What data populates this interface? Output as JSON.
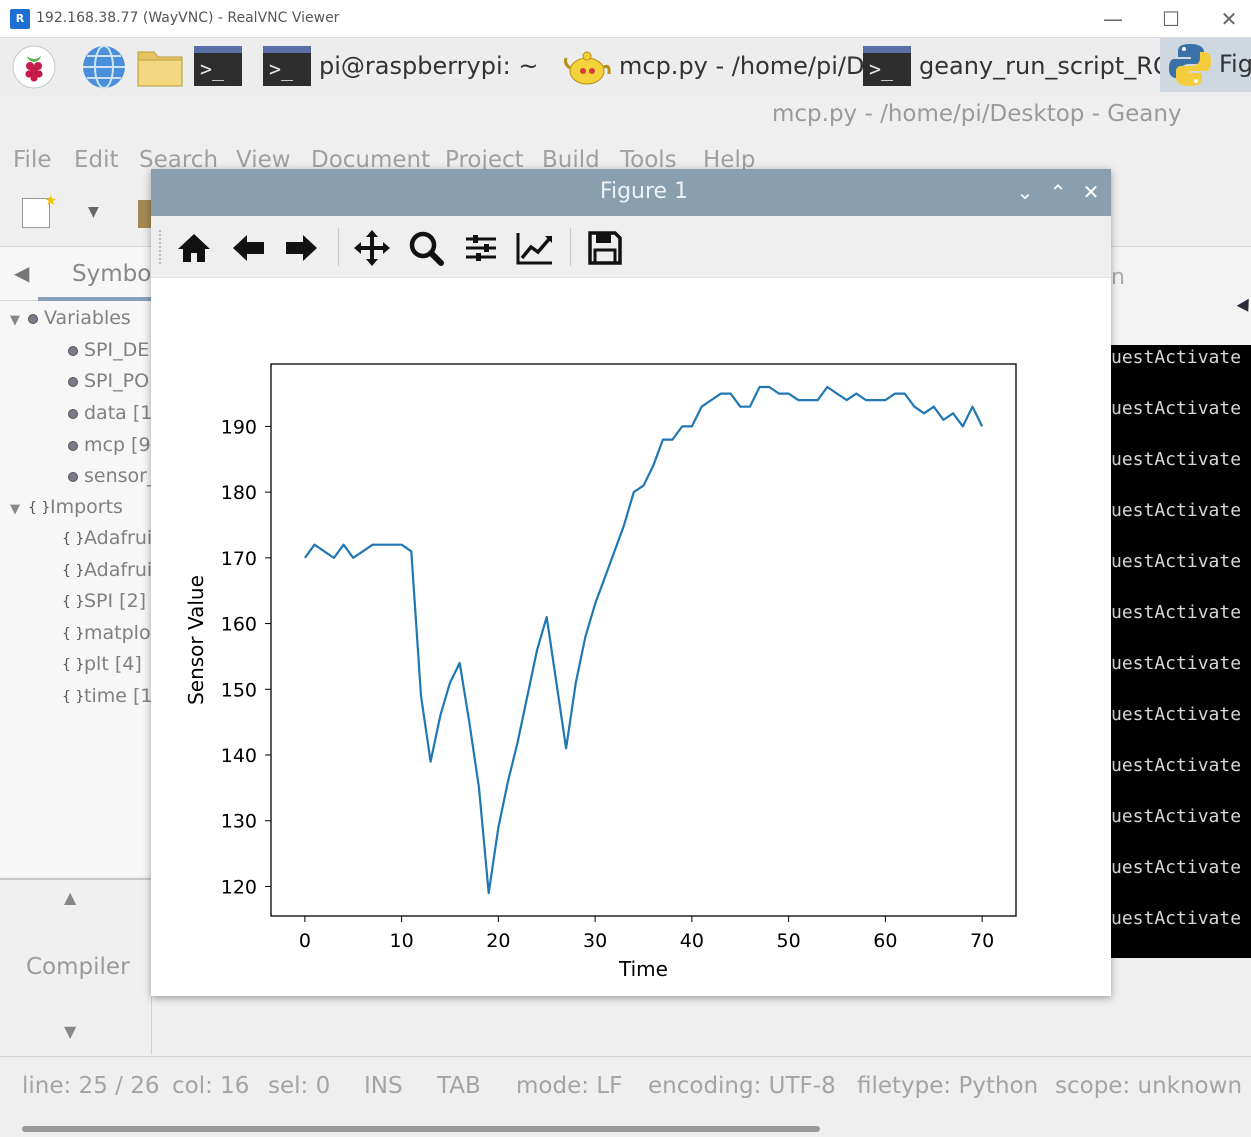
{
  "vnc": {
    "title": "192.168.38.77 (WayVNC) - RealVNC Viewer",
    "logo": "R"
  },
  "taskbar": {
    "tasks": [
      {
        "label": "pi@raspberrypi: ~"
      },
      {
        "label": "mcp.py - /home/pi/D.."
      },
      {
        "label": "geany_run_script_RO.."
      },
      {
        "label": "Fig"
      }
    ],
    "terminal_glyph": ">_"
  },
  "geany": {
    "title": "mcp.py - /home/pi/Desktop - Geany",
    "menu": [
      "File",
      "Edit",
      "Search",
      "View",
      "Document",
      "Project",
      "Build",
      "Tools",
      "Help"
    ],
    "sidebar_tab": "Symbol",
    "tree": [
      {
        "label": "Variables",
        "kind": "group"
      },
      {
        "label": "SPI_DE",
        "kind": "var"
      },
      {
        "label": "SPI_PO",
        "kind": "var"
      },
      {
        "label": "data [1",
        "kind": "var"
      },
      {
        "label": "mcp [9",
        "kind": "var"
      },
      {
        "label": "sensor_",
        "kind": "var"
      },
      {
        "label": "Imports",
        "kind": "group"
      },
      {
        "label": "Adafrui",
        "kind": "import"
      },
      {
        "label": "Adafrui",
        "kind": "import"
      },
      {
        "label": "SPI [2]",
        "kind": "import"
      },
      {
        "label": "matplo",
        "kind": "import"
      },
      {
        "label": "plt [4]",
        "kind": "import"
      },
      {
        "label": "time [1",
        "kind": "import"
      }
    ],
    "compiler_label": "Compiler",
    "terminal_text": "uestActivate",
    "terminal_lines": 12,
    "right_tab_fragment": "n",
    "status": {
      "line": "line: 25 / 26",
      "col": "col: 16",
      "sel": "sel: 0",
      "ins": "INS",
      "tab": "TAB",
      "mode": "mode: LF",
      "encoding": "encoding: UTF-8",
      "filetype": "filetype: Python",
      "scope": "scope: unknown"
    }
  },
  "figure": {
    "title": "Figure 1",
    "toolbar_icons": [
      "home-icon",
      "back-arrow-icon",
      "forward-arrow-icon",
      "pan-move-icon",
      "zoom-magnifier-icon",
      "configure-subplots-icon",
      "edit-axis-icon",
      "save-floppy-icon"
    ],
    "line_color": "#1f77b4"
  },
  "chart_data": {
    "type": "line",
    "title": "",
    "xlabel": "Time",
    "ylabel": "Sensor Value",
    "xlim": [
      -3.5,
      73.5
    ],
    "ylim": [
      115.5,
      199.5
    ],
    "xticks": [
      0,
      10,
      20,
      30,
      40,
      50,
      60,
      70
    ],
    "yticks": [
      120,
      130,
      140,
      150,
      160,
      170,
      180,
      190
    ],
    "grid": false,
    "series": [
      {
        "x": [
          0,
          1,
          2,
          3,
          4,
          5,
          6,
          7,
          8,
          9,
          10,
          11,
          12,
          13,
          14,
          15,
          16,
          17,
          18,
          19,
          20,
          21,
          22,
          23,
          24,
          25,
          26,
          27,
          28,
          29,
          30,
          31,
          32,
          33,
          34,
          35,
          36,
          37,
          38,
          39,
          40,
          41,
          42,
          43,
          44,
          45,
          46,
          47,
          48,
          49,
          50,
          51,
          52,
          53,
          54,
          55,
          56,
          57,
          58,
          59,
          60,
          61,
          62,
          63,
          64,
          65,
          66,
          67,
          68,
          69,
          70
        ],
        "y": [
          170,
          172,
          171,
          170,
          172,
          170,
          171,
          172,
          172,
          172,
          172,
          171,
          149,
          139,
          146,
          151,
          154,
          145,
          135,
          119,
          129,
          136,
          142,
          149,
          156,
          161,
          151,
          141,
          151,
          158,
          163,
          167,
          171,
          175,
          180,
          181,
          184,
          188,
          188,
          190,
          190,
          193,
          194,
          195,
          195,
          193,
          193,
          196,
          196,
          195,
          195,
          194,
          194,
          194,
          196,
          195,
          194,
          195,
          194,
          194,
          194,
          195,
          195,
          193,
          192,
          193,
          191,
          192,
          190,
          193,
          190
        ]
      }
    ]
  }
}
